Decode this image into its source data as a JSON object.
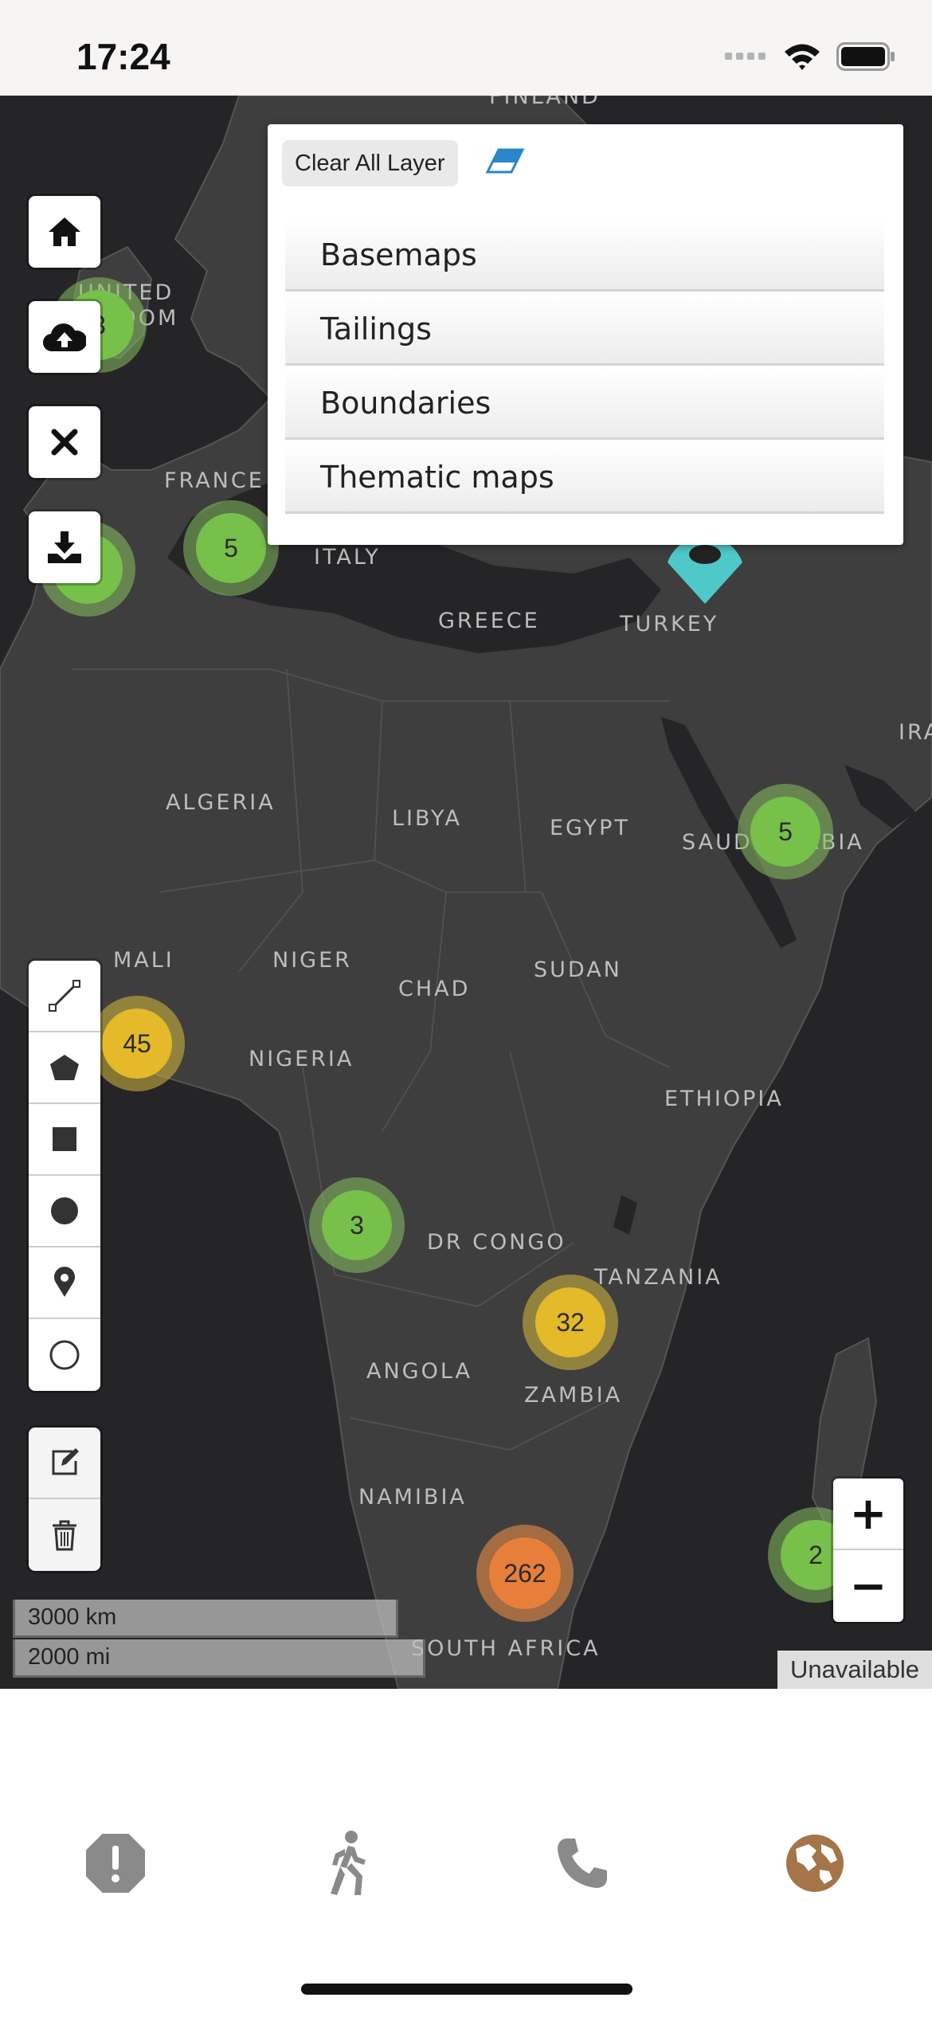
{
  "status_bar": {
    "time": "17:24",
    "icons": [
      "signal-icon",
      "wifi-icon",
      "battery-icon"
    ]
  },
  "layer_panel": {
    "clear_label": "Clear All Layer",
    "layers": [
      "Basemaps",
      "Tailings",
      "Boundaries",
      "Thematic maps"
    ]
  },
  "map": {
    "labels": {
      "finland": "FINLAND",
      "united": "UNITED",
      "kingdom": "GDOM",
      "france": "FRANCE",
      "italy": "ITALY",
      "greece": "GREECE",
      "turkey": "TURKEY",
      "iran": "IRA",
      "algeria": "ALGERIA",
      "libya": "LIBYA",
      "egypt": "EGYPT",
      "saudi": "SAUDI ARABIA",
      "mali": "MALI",
      "niger": "NIGER",
      "chad": "CHAD",
      "sudan": "SUDAN",
      "nigeria": "NIGERIA",
      "ethiopia": "ETHIOPIA",
      "drcongo": "DR CONGO",
      "tanzania": "TANZANIA",
      "angola": "ANGOLA",
      "zambia": "ZAMBIA",
      "namibia": "NAMIBIA",
      "south_africa": "SOUTH AFRICA"
    },
    "clusters": {
      "uk": "3",
      "france": "5",
      "saudi": "5",
      "west_africa": "45",
      "congo": "3",
      "zambia": "32",
      "south_africa": "262",
      "madagascar": "2"
    },
    "scale_km": "3000 km",
    "scale_mi": "2000 mi",
    "attribution": "Unavailable"
  },
  "zoom": {
    "in": "+",
    "out": "−"
  },
  "colors": {
    "accent_brown": "#a47548",
    "cluster_green": "#77c04a",
    "cluster_yellow": "#e4b92a",
    "cluster_orange": "#e77f3a",
    "marker_teal": "#4ec8c8",
    "eraser_blue": "#2a86c6"
  }
}
